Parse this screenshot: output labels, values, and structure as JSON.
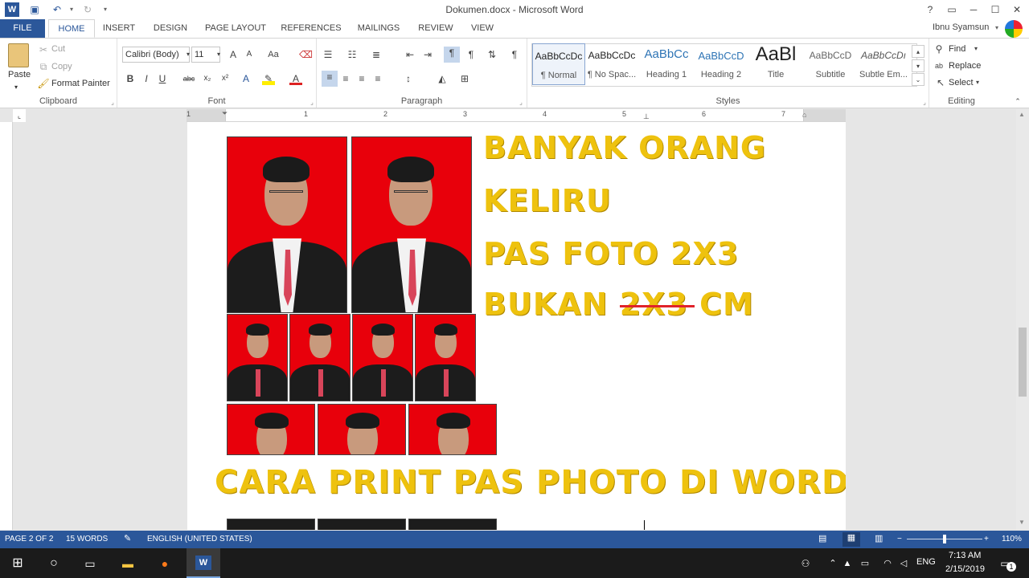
{
  "titlebar": {
    "title": "Dokumen.docx - Microsoft Word",
    "help": "?",
    "restore": "▭",
    "minimize": "─",
    "maximize": "☐",
    "close": "✕"
  },
  "tabs": [
    "FILE",
    "HOME",
    "INSERT",
    "DESIGN",
    "PAGE LAYOUT",
    "REFERENCES",
    "MAILINGS",
    "REVIEW",
    "VIEW"
  ],
  "user": {
    "name": "Ibnu Syamsun"
  },
  "clipboard": {
    "label": "Clipboard",
    "paste": "Paste",
    "cut": "Cut",
    "copy": "Copy",
    "format_painter": "Format Painter"
  },
  "font": {
    "label": "Font",
    "family": "Calibri (Body)",
    "size": "11",
    "bold": "B",
    "italic": "I",
    "underline": "U",
    "strike": "abc",
    "sub": "x₂",
    "sup": "x²",
    "case": "Aa"
  },
  "paragraph": {
    "label": "Paragraph"
  },
  "styles": {
    "label": "Styles",
    "items": [
      {
        "sample": "AaBbCcDc",
        "name": "¶ Normal"
      },
      {
        "sample": "AaBbCcDc",
        "name": "¶ No Spac..."
      },
      {
        "sample": "AaBbCc",
        "name": "Heading 1"
      },
      {
        "sample": "AaBbCcD",
        "name": "Heading 2"
      },
      {
        "sample": "AaBl",
        "name": "Title"
      },
      {
        "sample": "AaBbCcD",
        "name": "Subtitle"
      },
      {
        "sample": "AaBbCcDı",
        "name": "Subtle Em..."
      }
    ]
  },
  "editing": {
    "label": "Editing",
    "find": "Find",
    "replace": "Replace",
    "select": "Select"
  },
  "document": {
    "line1": "BANYAK ORANG",
    "line2": "KELIRU",
    "line3": "PAS FOTO 2X3",
    "line4_a": "BUKAN ",
    "line4_strike": "2X3",
    "line4_b": " CM",
    "headline": "CARA PRINT PAS PHOTO DI WORD"
  },
  "ruler": {
    "marks": [
      "1",
      "1",
      "2",
      "3",
      "4",
      "5",
      "6",
      "7"
    ]
  },
  "status": {
    "page": "PAGE 2 OF 2",
    "words": "15 WORDS",
    "language": "ENGLISH (UNITED STATES)",
    "zoom": "110%"
  },
  "taskbar": {
    "lang": "ENG",
    "time": "7:13 AM",
    "date": "2/15/2019",
    "notifications": "1"
  },
  "colors": {
    "accent": "#2b579a",
    "headline": "#eec20e",
    "photo_bg": "#e8000b"
  }
}
